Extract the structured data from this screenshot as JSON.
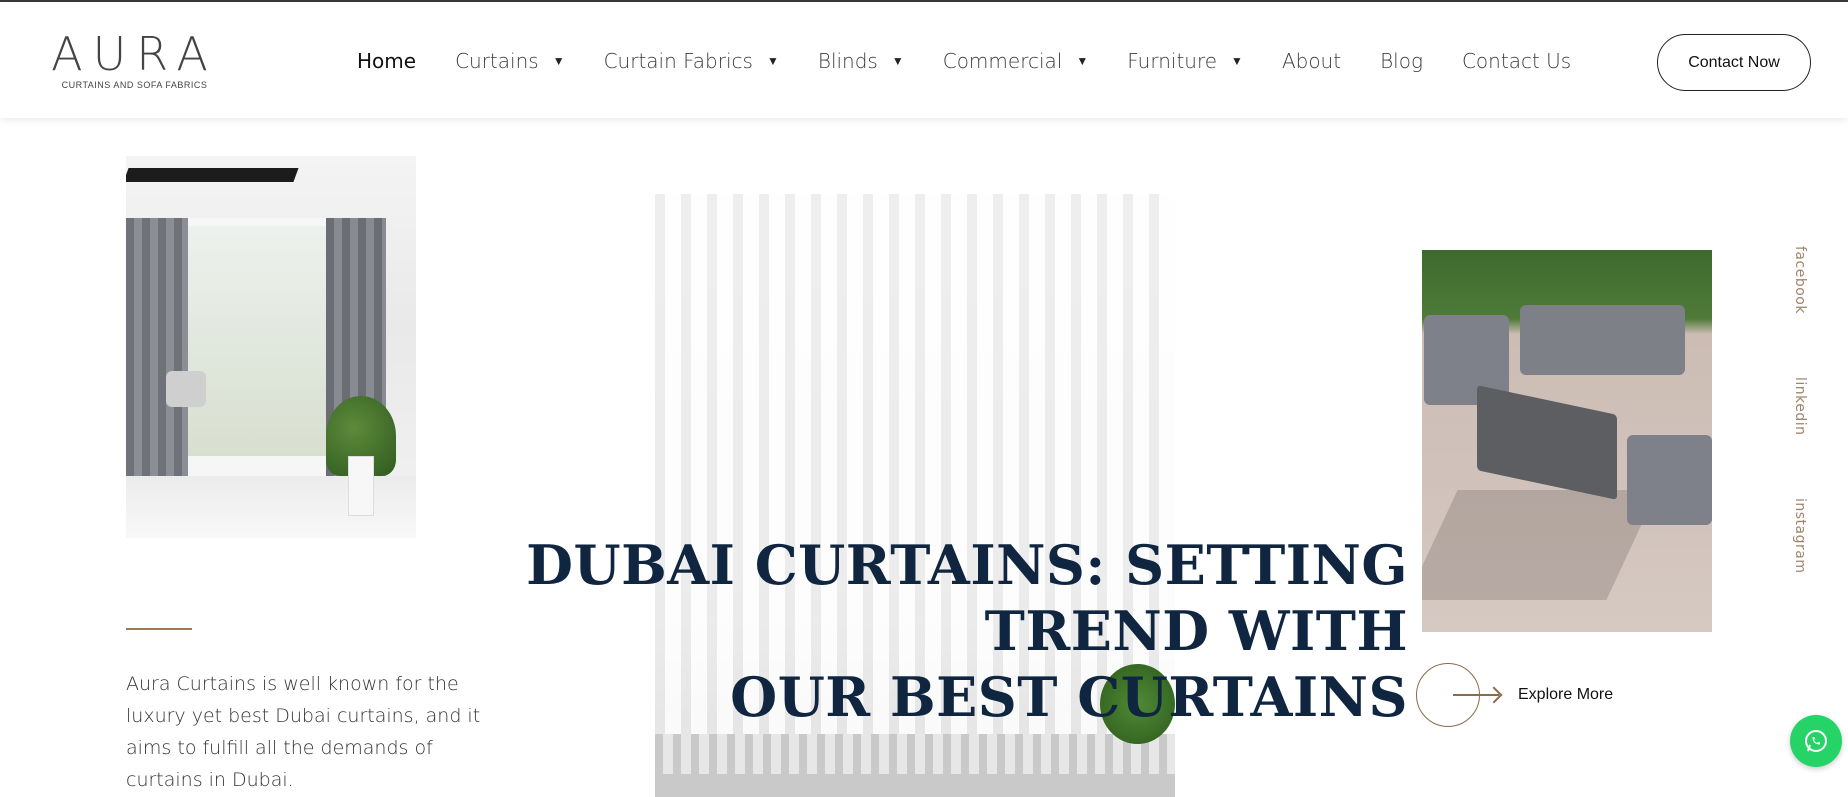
{
  "brand": {
    "name": "AURA",
    "tagline": "CURTAINS AND SOFA FABRICS"
  },
  "nav": {
    "items": [
      {
        "label": "Home",
        "active": true,
        "has_dropdown": false
      },
      {
        "label": "Curtains",
        "active": false,
        "has_dropdown": true
      },
      {
        "label": "Curtain Fabrics",
        "active": false,
        "has_dropdown": true
      },
      {
        "label": "Blinds",
        "active": false,
        "has_dropdown": true
      },
      {
        "label": "Commercial",
        "active": false,
        "has_dropdown": true
      },
      {
        "label": "Furniture",
        "active": false,
        "has_dropdown": true
      },
      {
        "label": "About",
        "active": false,
        "has_dropdown": false
      },
      {
        "label": "Blog",
        "active": false,
        "has_dropdown": false
      },
      {
        "label": "Contact Us",
        "active": false,
        "has_dropdown": false
      }
    ],
    "caret": "▼",
    "cta_label": "Contact Now"
  },
  "hero": {
    "headline_line1": "DUBAI CURTAINS: SETTING TREND WITH",
    "headline_line2": "OUR BEST CURTAINS",
    "intro": "Aura Curtains is well known for the luxury yet best Dubai curtains, and it aims to fulfill all the demands of curtains in Dubai.",
    "explore_label": "Explore More"
  },
  "social": {
    "facebook": "facebook",
    "linkedin": "linkedin",
    "instagram": "instagram"
  },
  "colors": {
    "headline": "#0f2540",
    "accent": "#8a6b4a",
    "social": "#a0846a",
    "whatsapp": "#25d366"
  },
  "icons": {
    "whatsapp": "whatsapp-icon",
    "arrow": "arrow-right-icon",
    "caret": "chevron-down-icon"
  }
}
